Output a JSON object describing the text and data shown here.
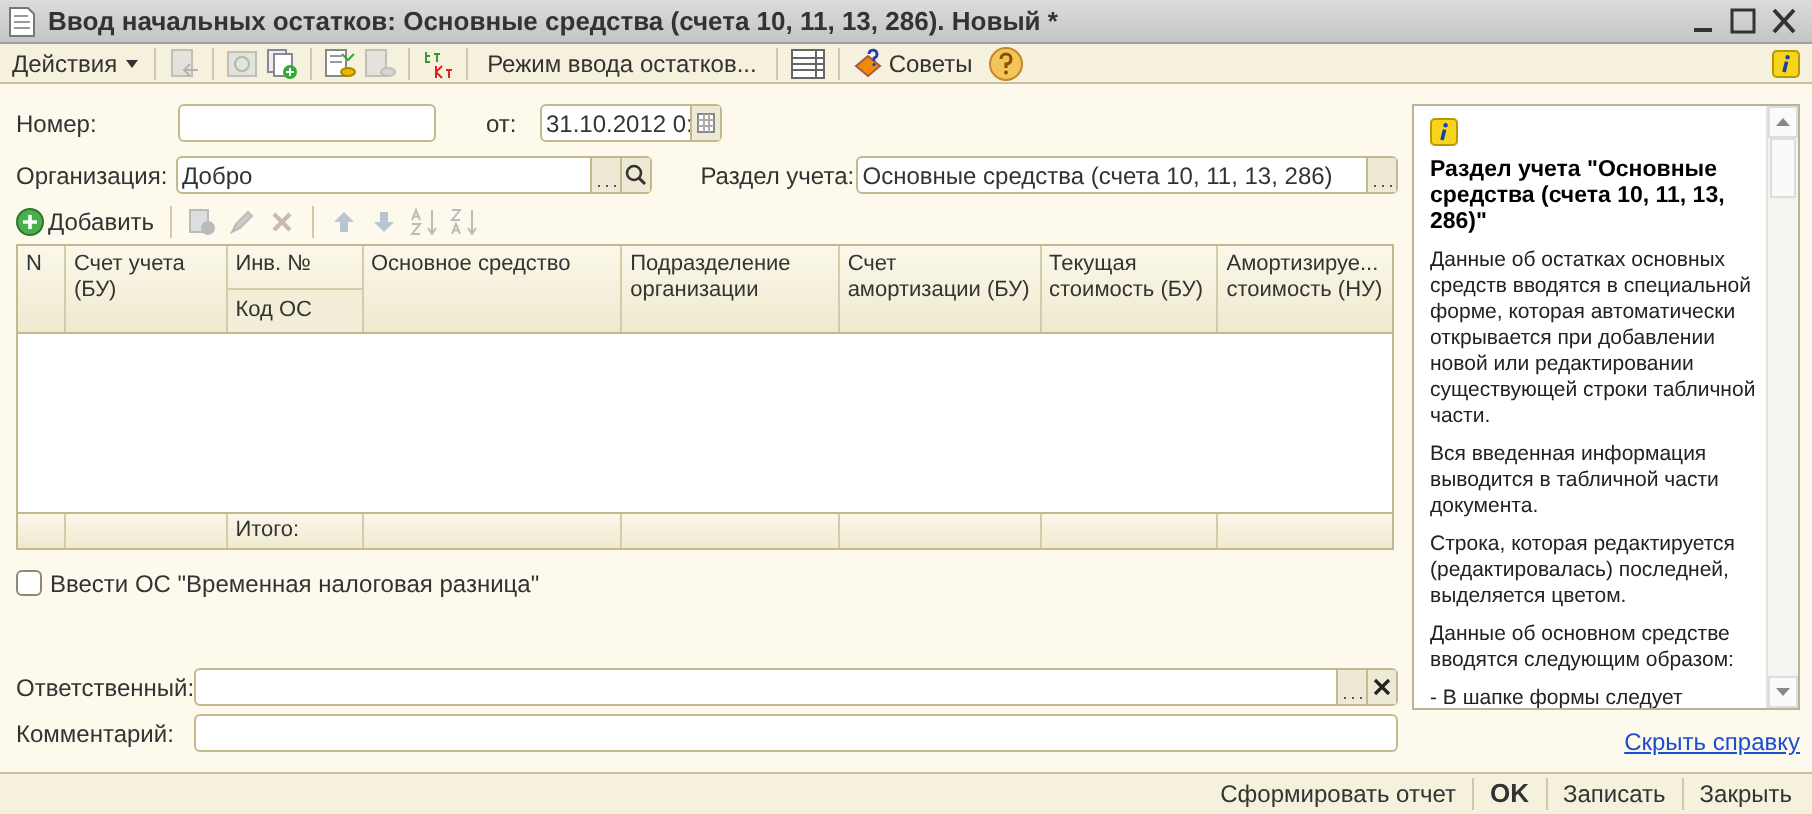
{
  "window": {
    "title": "Ввод начальных остатков: Основные средства (счета 10, 11, 13, 286). Новый *"
  },
  "toolbar": {
    "actions_menu": "Действия",
    "mode_button": "Режим ввода остатков...",
    "tips_button": "Советы"
  },
  "form": {
    "number": {
      "label": "Номер:"
    },
    "date": {
      "label": "от:",
      "value": "31.10.2012 0:"
    },
    "organization": {
      "label": "Организация:",
      "value": "Добро"
    },
    "section": {
      "label": "Раздел учета:",
      "value": "Основные средства (счета 10, 11, 13, 286)"
    }
  },
  "table_toolbar": {
    "add_button": "Добавить"
  },
  "table": {
    "columns": [
      {
        "label": "N"
      },
      {
        "label": "Счет учета\n(БУ)"
      },
      {
        "label": "Инв. №",
        "sublabel": "Код ОС"
      },
      {
        "label": "Основное средство"
      },
      {
        "label": "Подразделение\nорганизации"
      },
      {
        "label": "Счет\nамортизации (БУ)"
      },
      {
        "label": "Текущая\nстоимость (БУ)"
      },
      {
        "label": "Амортизируе...\nстоимость (НУ)"
      }
    ],
    "totals_label": "Итого:"
  },
  "temp_difference_checkbox": {
    "label": "Ввести ОС \"Временная налоговая разница\"",
    "checked": false
  },
  "responsible": {
    "label": "Ответственный:"
  },
  "comment": {
    "label": "Комментарий:"
  },
  "help": {
    "title": "Раздел учета \"Основные средства (счета 10, 11, 13, 286)\"",
    "paragraphs": [
      "Данные об остатках основных средств вводятся в специальной форме, которая автоматически открывается при добавлении новой или редактировании существующей строки табличной части.",
      "Вся введенная информация выводится в табличной части документа.",
      "Строка, которая редактируется (редактировалась) последней, выделяется цветом.",
      "Данные об основном средстве вводятся следующим образом:",
      "- В шапке формы следует"
    ],
    "hide_link": "Скрыть справку"
  },
  "footer_buttons": [
    {
      "label": "Сформировать отчет",
      "kind": "normal"
    },
    {
      "label": "OK",
      "kind": "default"
    },
    {
      "label": "Записать",
      "kind": "normal"
    },
    {
      "label": "Закрыть",
      "kind": "normal"
    }
  ]
}
